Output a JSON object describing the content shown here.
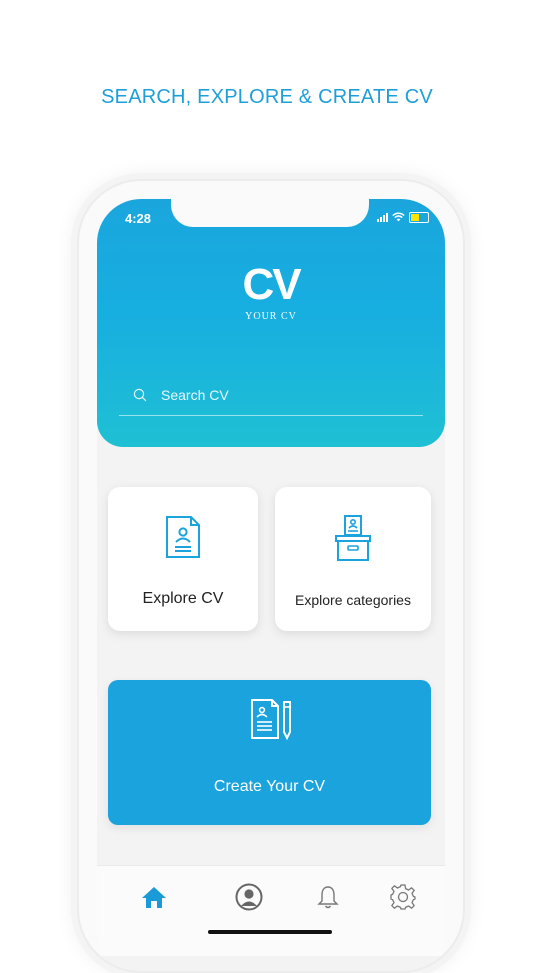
{
  "headline": "SEARCH, EXPLORE & CREATE CV",
  "status": {
    "time": "4:28"
  },
  "logo": {
    "mark": "CV",
    "subtitle": "YOUR CV"
  },
  "search": {
    "placeholder": "Search CV",
    "value": ""
  },
  "cards": {
    "explore_cv": "Explore CV",
    "explore_categories": "Explore categories",
    "create_cv": "Create Your CV"
  },
  "tabs": [
    {
      "name": "home",
      "icon": "home-icon",
      "active": true
    },
    {
      "name": "profile",
      "icon": "user-icon",
      "active": false
    },
    {
      "name": "notifications",
      "icon": "bell-icon",
      "active": false
    },
    {
      "name": "settings",
      "icon": "gear-icon",
      "active": false
    }
  ],
  "colors": {
    "accent": "#1aa3dc",
    "gradient_end": "#1fc0d4",
    "active_tab": "#1a9ad6",
    "inactive_tab": "#777777"
  }
}
